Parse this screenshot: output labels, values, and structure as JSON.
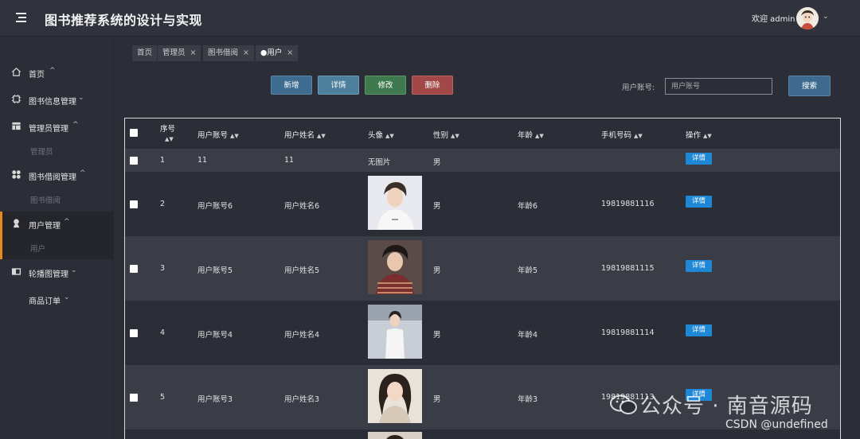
{
  "header": {
    "title": "图书推荐系统的设计与实现",
    "welcome": "欢迎 admin"
  },
  "sidebar": {
    "items": [
      {
        "label": "首页",
        "icon": "home-icon"
      },
      {
        "label": "图书信息管理",
        "icon": "chip-icon"
      },
      {
        "label": "管理员管理",
        "icon": "table-icon"
      },
      {
        "label": "管理员",
        "sub": true
      },
      {
        "label": "图书借阅管理",
        "icon": "grid-icon"
      },
      {
        "label": "图书借阅",
        "sub": true
      },
      {
        "label": "用户管理",
        "icon": "user-icon"
      },
      {
        "label": "用户",
        "sub": true
      },
      {
        "label": "轮播图管理",
        "icon": "carousel-icon"
      },
      {
        "label": "商品订单",
        "icon": ""
      }
    ]
  },
  "tabs": [
    {
      "label": "首页",
      "closable": false
    },
    {
      "label": "管理员",
      "closable": true
    },
    {
      "label": "图书借阅",
      "closable": true
    },
    {
      "label": "●用户",
      "closable": true
    }
  ],
  "toolbar": {
    "add": "新增",
    "detail": "详情",
    "edit": "修改",
    "delete": "删除",
    "search_label": "用户账号:",
    "search_placeholder": "用户账号",
    "search_button": "搜索"
  },
  "table": {
    "headers": [
      "序号",
      "用户账号",
      "用户姓名",
      "头像",
      "性别",
      "年龄",
      "手机号码",
      "操作"
    ],
    "rows": [
      {
        "no": "1",
        "account": "11",
        "name": "11",
        "avatar": "无图片",
        "gender": "男",
        "age": "",
        "phone": "",
        "action": "详情"
      },
      {
        "no": "2",
        "account": "用户账号6",
        "name": "用户姓名6",
        "avatar": "",
        "gender": "男",
        "age": "年龄6",
        "phone": "19819881116",
        "action": "详情"
      },
      {
        "no": "3",
        "account": "用户账号5",
        "name": "用户姓名5",
        "avatar": "",
        "gender": "男",
        "age": "年龄5",
        "phone": "19819881115",
        "action": "详情"
      },
      {
        "no": "4",
        "account": "用户账号4",
        "name": "用户姓名4",
        "avatar": "",
        "gender": "男",
        "age": "年龄4",
        "phone": "19819881114",
        "action": "详情"
      },
      {
        "no": "5",
        "account": "用户账号3",
        "name": "用户姓名3",
        "avatar": "",
        "gender": "男",
        "age": "年龄3",
        "phone": "19819881113",
        "action": "详情"
      }
    ]
  },
  "watermark": {
    "line1": "公众号 · 南音源码",
    "line2": "CSDN @undefined"
  },
  "colors": {
    "accent_orange": "#e88a1a",
    "action_blue": "#1e88d6",
    "delete_red": "#a34848",
    "edit_green": "#3f7a4e"
  }
}
